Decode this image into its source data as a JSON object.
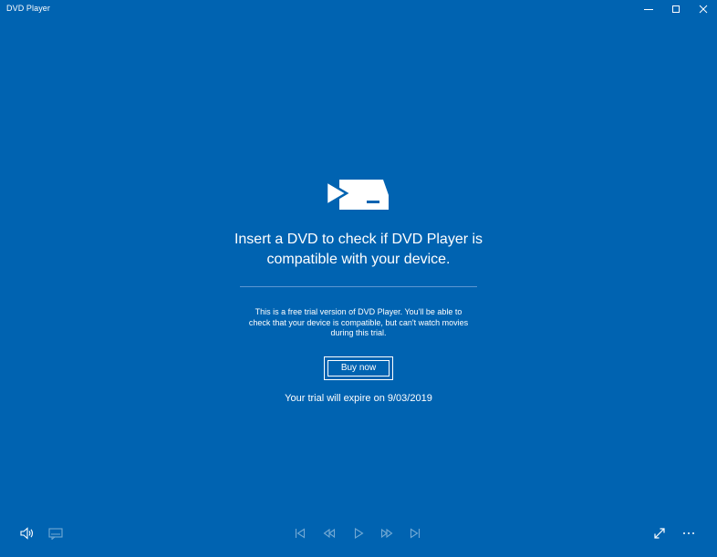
{
  "window": {
    "title": "DVD Player",
    "controls": [
      "minimize",
      "maximize",
      "close"
    ]
  },
  "main": {
    "icon": "dvd-drive-icon",
    "headline": "Insert a DVD to check if DVD Player is compatible with your device.",
    "trial_notice": "This is a free trial version of DVD Player. You'll be able to check that your device is compatible, but can't watch movies during this trial.",
    "buy_label": "Buy now",
    "expiry_text": "Your trial will expire on 9/03/2019"
  },
  "toolbar": {
    "left": [
      "volume-icon",
      "subtitles-icon"
    ],
    "center": [
      "previous-chapter-icon",
      "rewind-icon",
      "play-icon",
      "fast-forward-icon",
      "next-chapter-icon"
    ],
    "right": [
      "fullscreen-icon",
      "more-options-icon"
    ]
  },
  "colors": {
    "background": "#0063b1",
    "foreground": "#ffffff",
    "divider": "#5c97d2"
  }
}
